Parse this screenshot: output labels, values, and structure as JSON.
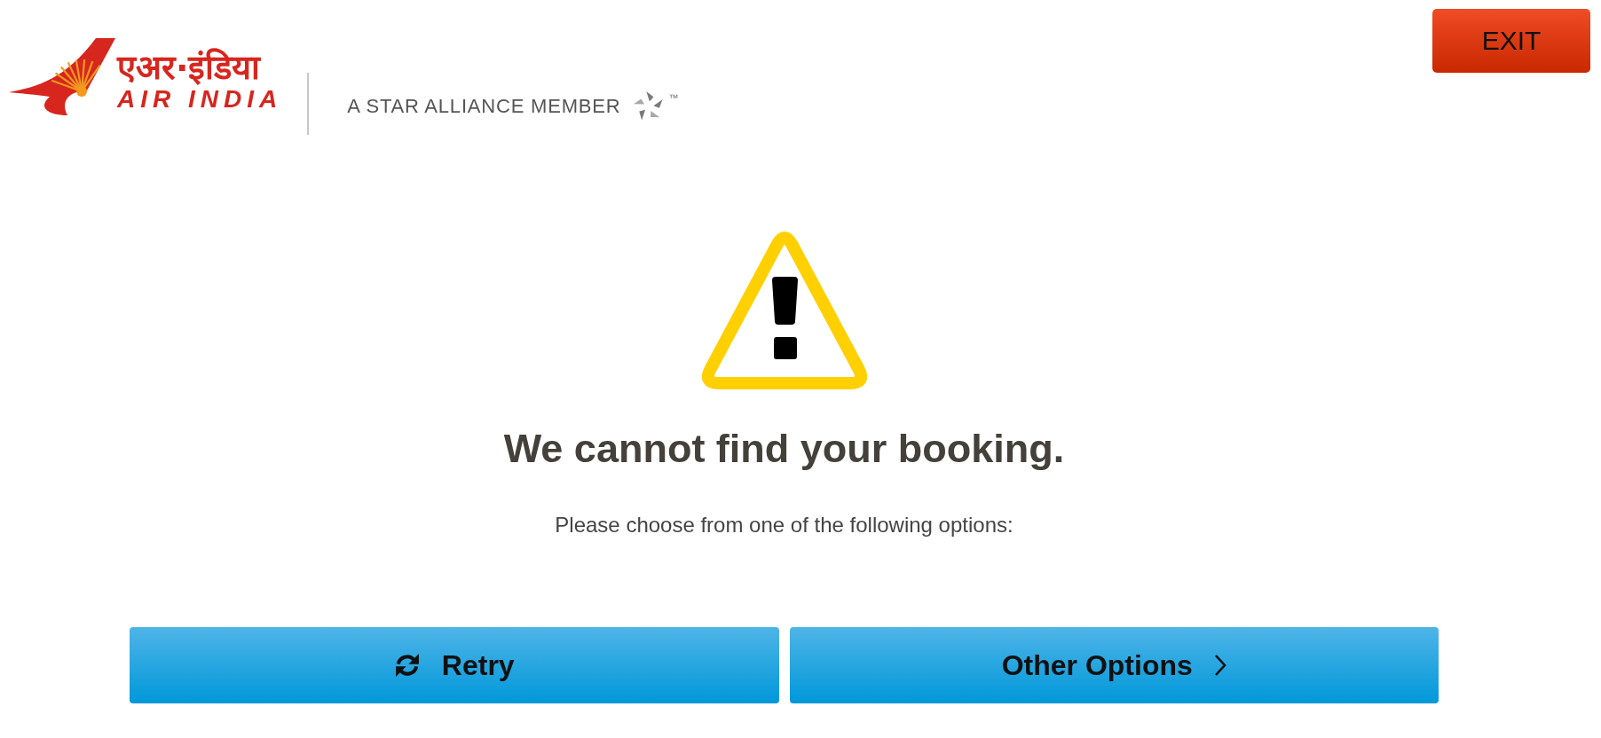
{
  "header": {
    "logo": {
      "hindi_text": "एअर·इंडिया",
      "text": "AIR INDIA"
    },
    "alliance": {
      "text": "A STAR ALLIANCE MEMBER",
      "trademark": "™"
    },
    "exit_button": {
      "label": "EXIT"
    }
  },
  "message": {
    "title": "We cannot find your booking.",
    "subtitle": "Please choose from one of the following options:"
  },
  "actions": [
    {
      "label": "Retry",
      "kind": "retry"
    },
    {
      "label": "Other Options",
      "kind": "next"
    }
  ]
}
